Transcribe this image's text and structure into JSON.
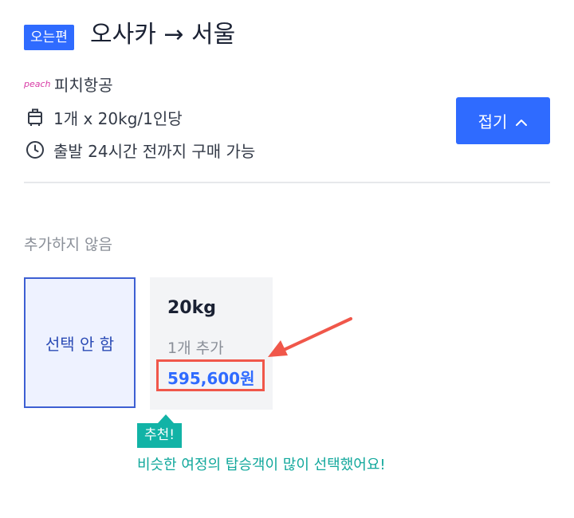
{
  "header": {
    "badge": "오는편",
    "route": "오사카 → 서울"
  },
  "info": {
    "airline_logo": "peach",
    "airline_name": "피치항공",
    "baggage_allowance": "1개 x 20kg/1인당",
    "purchase_deadline": "출발 24시간 전까지 구매 가능"
  },
  "fold_button": {
    "label": "접기",
    "icon": "chevron-up-icon"
  },
  "section": {
    "label": "추가하지 않음"
  },
  "options": {
    "none": {
      "label": "선택 안 함"
    },
    "kg20": {
      "weight": "20kg",
      "count": "1개 추가",
      "price": "595,600원"
    }
  },
  "recommendation": {
    "tag": "추천!",
    "message": "비슷한 여정의 탑승객이 많이 선택했어요!"
  },
  "colors": {
    "primary": "#2f6bff",
    "selected_border": "#3d5fd3",
    "highlight_red": "#f0574a",
    "teal": "#12b3a6"
  }
}
